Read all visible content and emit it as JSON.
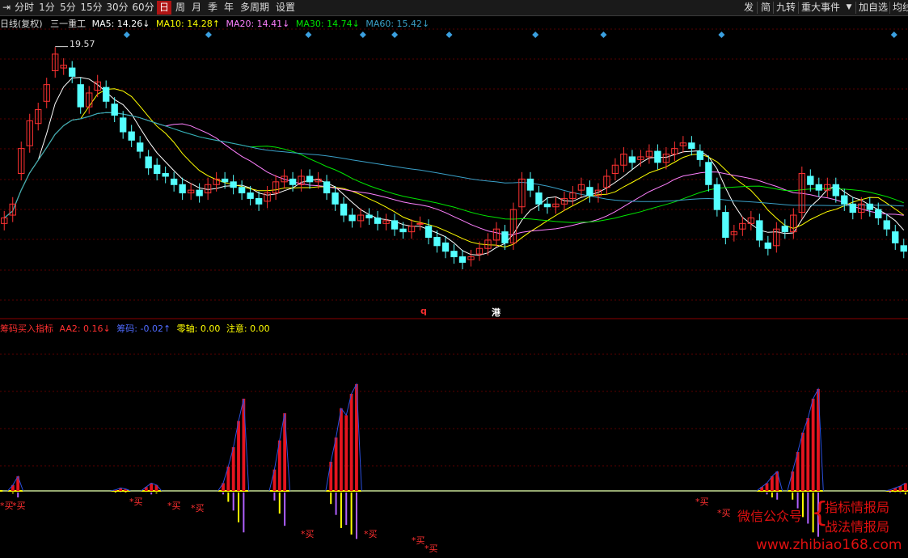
{
  "toolbar": {
    "left_icon": "pan-right-icon",
    "periods": [
      "分时",
      "1分",
      "5分",
      "15分",
      "30分",
      "60分",
      "日",
      "周",
      "月",
      "季",
      "年",
      "多周期",
      "设置"
    ],
    "active_period": "日",
    "right_items": [
      "发",
      "简",
      "九转",
      "重大事件",
      "加自选",
      "均线"
    ],
    "dropdown_icon": "caret-down-icon"
  },
  "main_info": {
    "chart_name": "日线(复权)",
    "stock": "三一重工",
    "ma5": "MA5: 14.26↓",
    "ma10": "MA10: 14.28↑",
    "ma20": "MA20: 14.41↓",
    "ma30": "MA30: 14.74↓",
    "ma60": "MA60: 15.42↓"
  },
  "sub_info": {
    "indicator": "筹码买入指标",
    "aa2": "AA2: 0.16↓",
    "chouma": "筹码: -0.02↑",
    "zero": "零轴: 0.00",
    "attention": "注意: 0.00"
  },
  "markers": {
    "high_price": "19.57",
    "q_label": "q",
    "gang_label": "港",
    "buy_label": "*买"
  },
  "watermark": {
    "line1": "微信公众号",
    "line2a": "指标情报局",
    "line2b": "战法情报局",
    "url": "www.zhibiao168.com"
  },
  "colors": {
    "up": "#ff3232",
    "down": "#54ffff",
    "ma5": "#ffffff",
    "ma10": "#ffff00",
    "ma20": "#ff80ff",
    "ma30": "#00e600",
    "ma60": "#3aa0c8",
    "bar": "#e5141e",
    "yellow": "#ffff00",
    "blue": "#2b50e0",
    "purple": "#b060ff"
  },
  "chart_data": {
    "type": "candlestick",
    "price_high_label": 19.57,
    "closes": [
      13.4,
      13.9,
      15.9,
      16.9,
      17.3,
      18.2,
      19.3,
      18.9,
      18.5,
      17.4,
      17.9,
      18.3,
      17.6,
      17.1,
      16.5,
      16.2,
      15.8,
      15.2,
      15.0,
      14.9,
      14.6,
      14.3,
      14.4,
      14.2,
      14.6,
      14.8,
      14.7,
      14.5,
      14.3,
      14.1,
      13.9,
      14.3,
      14.7,
      14.9,
      14.6,
      14.9,
      14.7,
      14.8,
      14.3,
      13.9,
      13.5,
      13.3,
      13.5,
      13.4,
      13.2,
      13.3,
      13.0,
      12.9,
      13.1,
      13.2,
      12.7,
      12.4,
      12.2,
      12.0,
      11.8,
      12.0,
      12.3,
      12.6,
      13.0,
      12.5,
      13.7,
      14.8,
      14.4,
      13.9,
      13.8,
      13.9,
      14.1,
      14.3,
      14.6,
      14.2,
      14.4,
      14.9,
      15.3,
      15.7,
      15.4,
      15.6,
      15.8,
      15.4,
      15.7,
      15.9,
      16.1,
      15.9,
      15.5,
      14.6,
      13.7,
      12.7,
      12.9,
      13.2,
      13.4,
      12.6,
      12.3,
      13.0,
      12.9,
      13.5,
      15.0,
      14.6,
      14.4,
      14.6,
      14.2,
      13.9,
      13.6,
      13.9,
      13.7,
      13.4,
      13.0,
      12.5,
      12.2
    ],
    "opens": [
      13.2,
      13.5,
      15.0,
      16.0,
      16.8,
      17.6,
      18.7,
      18.8,
      18.8,
      18.2,
      17.4,
      18.0,
      18.1,
      17.5,
      17.0,
      16.5,
      16.1,
      15.6,
      15.3,
      15.0,
      14.8,
      14.6,
      14.3,
      14.4,
      14.3,
      14.6,
      14.8,
      14.7,
      14.5,
      14.3,
      14.1,
      14.0,
      14.3,
      14.7,
      14.8,
      14.6,
      14.9,
      14.7,
      14.7,
      14.3,
      13.9,
      13.5,
      13.3,
      13.5,
      13.4,
      13.2,
      13.3,
      13.0,
      12.9,
      13.2,
      13.1,
      12.7,
      12.5,
      12.2,
      12.0,
      11.9,
      12.1,
      12.3,
      12.6,
      12.9,
      12.5,
      13.8,
      14.8,
      14.3,
      13.9,
      13.8,
      13.9,
      14.1,
      14.4,
      14.5,
      14.2,
      14.5,
      15.0,
      15.3,
      15.6,
      15.5,
      15.6,
      15.8,
      15.4,
      15.7,
      16.0,
      16.1,
      15.8,
      15.4,
      14.6,
      13.6,
      12.8,
      13.0,
      13.2,
      13.3,
      12.5,
      12.4,
      13.1,
      12.9,
      13.6,
      14.9,
      14.6,
      14.4,
      14.6,
      14.2,
      13.9,
      13.6,
      13.9,
      13.7,
      13.3,
      12.9,
      12.4
    ],
    "ma_series": [
      "MA5",
      "MA10",
      "MA20",
      "MA30",
      "MA60"
    ],
    "signal_diamond_days": [
      27,
      45,
      67,
      79,
      86,
      98,
      117,
      132,
      158,
      196
    ],
    "indicator_bars": [
      0,
      0,
      0.06,
      0.15,
      0,
      0,
      0,
      0,
      0,
      0,
      0,
      0,
      0,
      0,
      0,
      0,
      0,
      0,
      0,
      0,
      0,
      0,
      0.01,
      0.03,
      0.02,
      0,
      0,
      0,
      0.04,
      0.08,
      0.06,
      0,
      0,
      0,
      0,
      0,
      0,
      0,
      0,
      0,
      0,
      0,
      0,
      0.08,
      0.25,
      0.45,
      0.72,
      0.95,
      0,
      0,
      0,
      0,
      0,
      0.22,
      0.52,
      0.8,
      0,
      0,
      0,
      0,
      0,
      0,
      0,
      0,
      0.3,
      0.55,
      0.85,
      0.78,
      1.0,
      1.1,
      0,
      0,
      0,
      0,
      0,
      0,
      0,
      0,
      0,
      0,
      0,
      0,
      0,
      0,
      0,
      0,
      0,
      0,
      0,
      0,
      0,
      0,
      0,
      0,
      0,
      0,
      0,
      0,
      0,
      0,
      0,
      0,
      0,
      0,
      0,
      0,
      0,
      0,
      0,
      0,
      0,
      0,
      0,
      0,
      0,
      0,
      0,
      0,
      0,
      0,
      0,
      0,
      0,
      0,
      0,
      0,
      0,
      0,
      0,
      0,
      0,
      0,
      0,
      0,
      0,
      0,
      0,
      0,
      0,
      0,
      0,
      0,
      0,
      0,
      0,
      0,
      0,
      0,
      0.04,
      0.08,
      0.15,
      0.2,
      0,
      0,
      0.2,
      0.4,
      0.6,
      0.75,
      0.95,
      1.05,
      0,
      0,
      0,
      0,
      0,
      0,
      0,
      0,
      0,
      0,
      0,
      0,
      0,
      0.01,
      0.03,
      0.05,
      0.08
    ]
  }
}
